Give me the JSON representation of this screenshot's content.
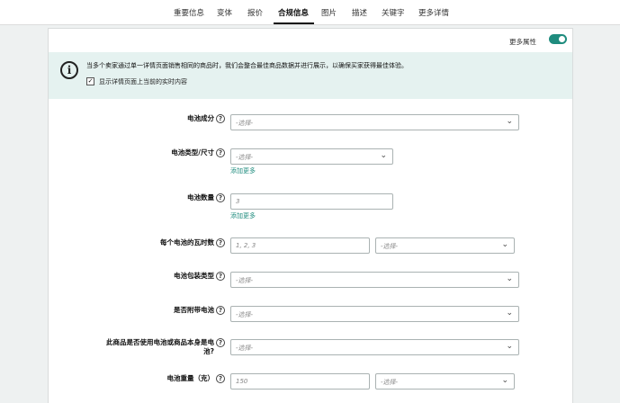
{
  "tabs": [
    {
      "label": "重要信息"
    },
    {
      "label": "变体"
    },
    {
      "label": "报价"
    },
    {
      "label": "合规信息"
    },
    {
      "label": "图片"
    },
    {
      "label": "描述"
    },
    {
      "label": "关键字"
    },
    {
      "label": "更多详情"
    }
  ],
  "active_tab": "合规信息",
  "toolbar": {
    "more_attributes_label": "更多属性",
    "more_attributes_on": true
  },
  "notice": {
    "text": "当多个卖家通过单一详情页面销售相同的商品时，我们会整合最佳商品数据并进行展示，以确保买家获得最佳体验。",
    "checkbox_label": "显示详情页面上当前的实时内容",
    "checkbox_checked": true
  },
  "fields": {
    "battery_composition": {
      "label": "电池成分",
      "value": "-选择-"
    },
    "battery_type": {
      "label": "电池类型/尺寸",
      "value": "-选择-",
      "add_more": "添加更多"
    },
    "battery_count": {
      "label": "电池数量",
      "placeholder": "3",
      "add_more": "添加更多"
    },
    "watt_hours": {
      "label": "每个电池的瓦时数",
      "placeholder": "1, 2, 3",
      "unit": "-选择-"
    },
    "battery_packaging": {
      "label": "电池包装类型",
      "value": "-选择-"
    },
    "batteries_included": {
      "label": "是否附带电池",
      "value": "-选择-"
    },
    "uses_battery": {
      "label": "此商品是否使用电池或商品本身是电池?",
      "value": "-选择-"
    },
    "battery_weight": {
      "label": "电池重量（克）",
      "placeholder": "150",
      "unit": "-选择-"
    }
  }
}
